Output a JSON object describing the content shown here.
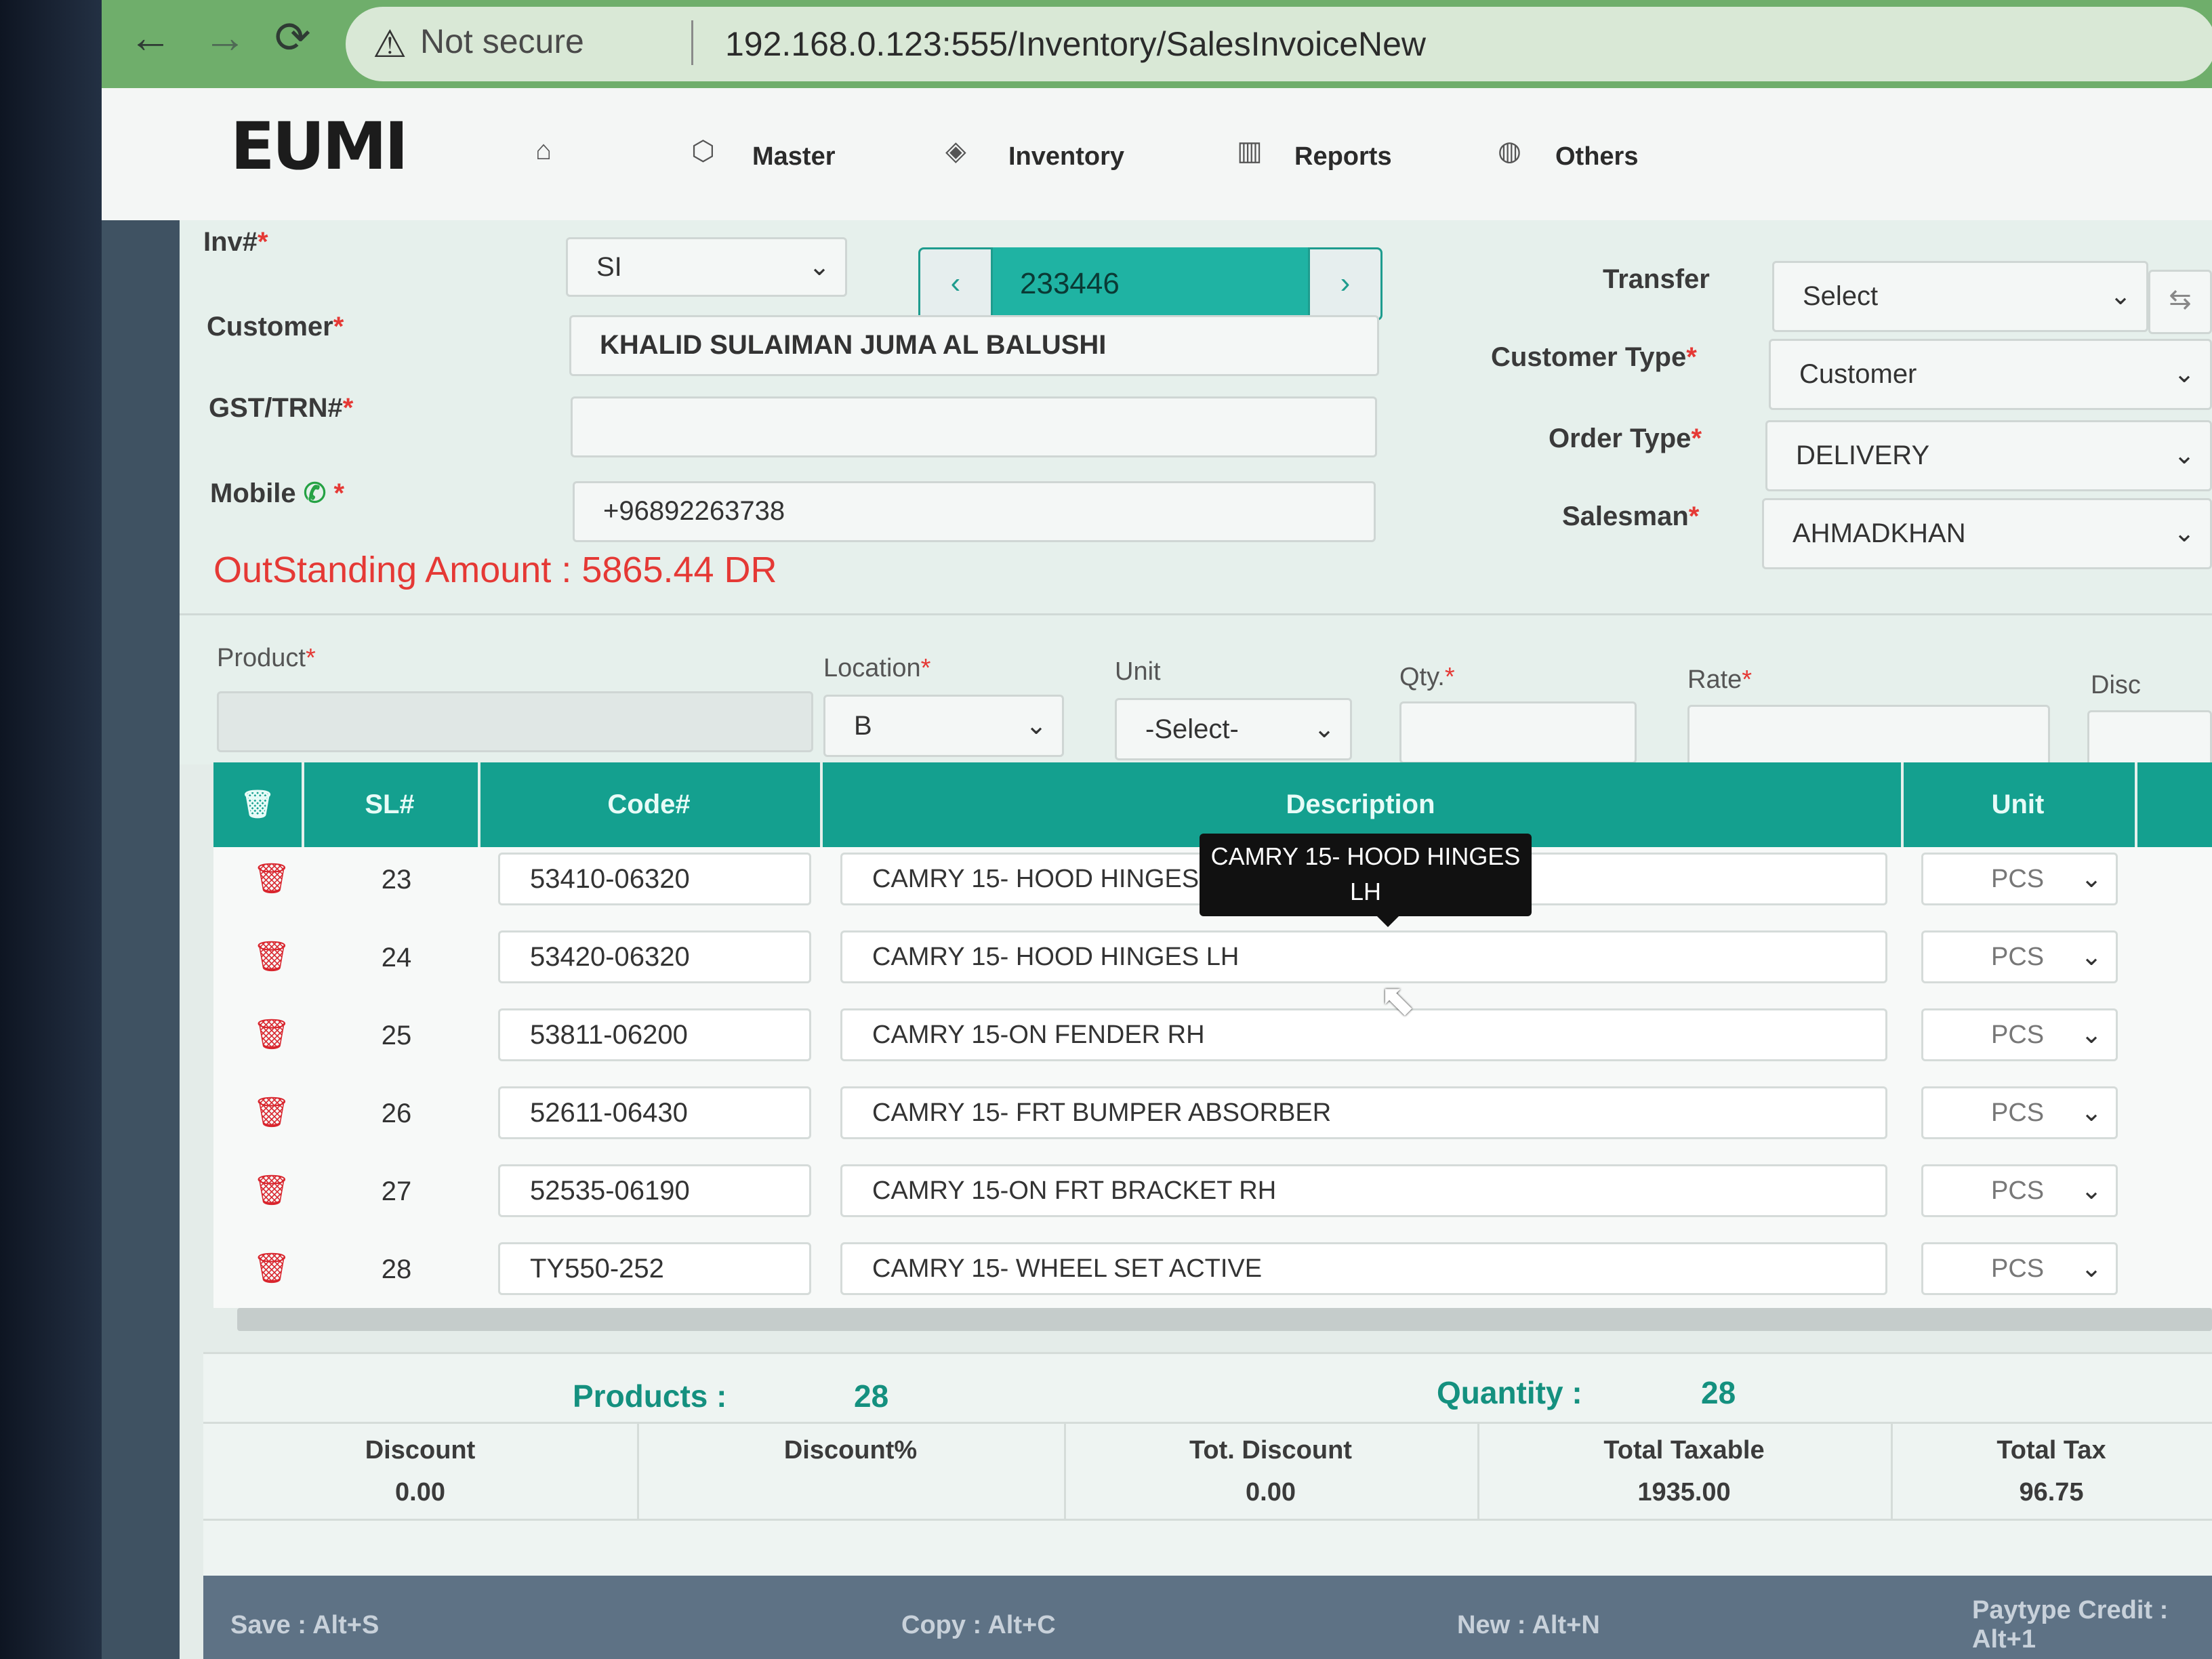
{
  "browser": {
    "not_secure": "Not secure",
    "url": "192.168.0.123:555/Inventory/SalesInvoiceNew"
  },
  "header": {
    "logo": "EUMI",
    "menu": [
      {
        "label": "Master"
      },
      {
        "label": "Inventory"
      },
      {
        "label": "Reports"
      },
      {
        "label": "Others"
      }
    ]
  },
  "form": {
    "inv_label": "Inv#",
    "inv_type": "SI",
    "inv_number": "233446",
    "customer_label": "Customer",
    "customer": "KHALID SULAIMAN JUMA AL BALUSHI",
    "gst_label": "GST/TRN#",
    "gst": "",
    "mobile_label": "Mobile",
    "mobile": "+96892263738",
    "outstanding": "OutStanding Amount : 5865.44 DR",
    "transfer_label": "Transfer",
    "transfer": "Select",
    "customer_type_label": "Customer Type",
    "customer_type": "Customer",
    "order_type_label": "Order Type",
    "order_type": "DELIVERY",
    "salesman_label": "Salesman",
    "salesman": "AHMADKHAN"
  },
  "entry": {
    "product_label": "Product",
    "location_label": "Location",
    "location": "B",
    "unit_label": "Unit",
    "unit": "-Select-",
    "qty_label": "Qty.",
    "rate_label": "Rate",
    "disc_label": "Disc"
  },
  "table": {
    "headers": {
      "sl": "SL#",
      "code": "Code#",
      "description": "Description",
      "unit": "Unit"
    },
    "rows": [
      {
        "sl": "23",
        "code": "53410-06320",
        "description": "CAMRY 15- HOOD HINGES",
        "unit": "PCS"
      },
      {
        "sl": "24",
        "code": "53420-06320",
        "description": "CAMRY 15- HOOD HINGES LH",
        "unit": "PCS"
      },
      {
        "sl": "25",
        "code": "53811-06200",
        "description": "CAMRY 15-ON FENDER RH",
        "unit": "PCS"
      },
      {
        "sl": "26",
        "code": "52611-06430",
        "description": "CAMRY 15- FRT BUMPER ABSORBER",
        "unit": "PCS"
      },
      {
        "sl": "27",
        "code": "52535-06190",
        "description": "CAMRY 15-ON FRT BRACKET RH",
        "unit": "PCS"
      },
      {
        "sl": "28",
        "code": "TY550-252",
        "description": "CAMRY 15- WHEEL SET ACTIVE",
        "unit": "PCS"
      }
    ],
    "tooltip_line1": "CAMRY 15- HOOD HINGES",
    "tooltip_line2": "LH"
  },
  "summary": {
    "products_label": "Products :",
    "products": "28",
    "quantity_label": "Quantity :",
    "quantity": "28",
    "discount_label": "Discount",
    "discount": "0.00",
    "discount_pct_label": "Discount%",
    "discount_pct": "",
    "tot_discount_label": "Tot. Discount",
    "tot_discount": "0.00",
    "total_taxable_label": "Total Taxable",
    "total_taxable": "1935.00",
    "total_tax_label": "Total Tax",
    "total_tax": "96.75"
  },
  "footer": {
    "save": "Save : Alt+S",
    "copy": "Copy : Alt+C",
    "new": "New : Alt+N",
    "paytype": "Paytype Credit : Alt+1"
  }
}
